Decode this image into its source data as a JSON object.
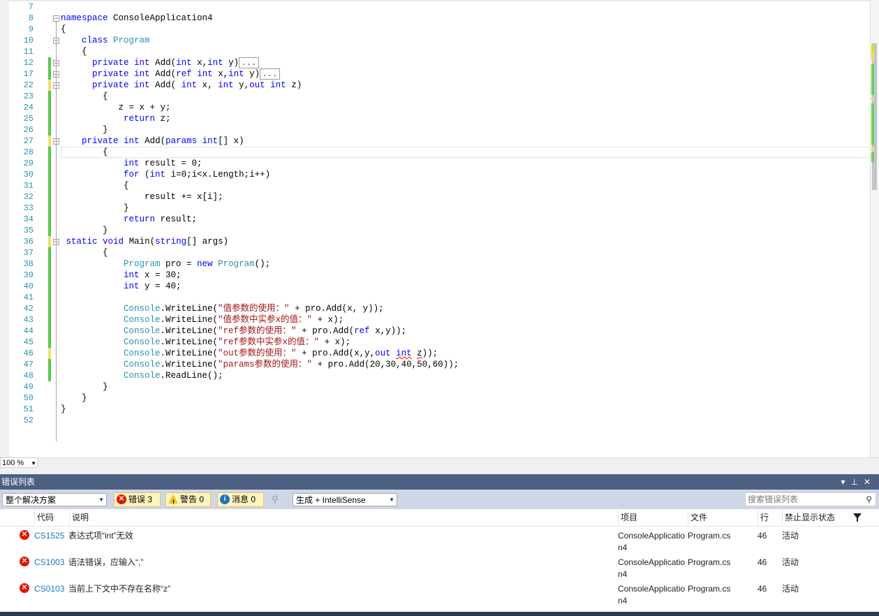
{
  "editor": {
    "lines": [
      {
        "n": "7",
        "segs": []
      },
      {
        "n": "8",
        "segs": [
          {
            "k": "kw",
            "t": "namespace"
          },
          {
            "t": " ConsoleApplication4"
          }
        ]
      },
      {
        "n": "9",
        "segs": [
          {
            "t": "{"
          }
        ]
      },
      {
        "n": "10",
        "segs": [
          {
            "t": "    "
          },
          {
            "k": "kw",
            "t": "class"
          },
          {
            "t": " "
          },
          {
            "k": "ty",
            "t": "Program"
          }
        ]
      },
      {
        "n": "11",
        "segs": [
          {
            "t": "    {"
          }
        ]
      },
      {
        "n": "12",
        "segs": [
          {
            "t": "      "
          },
          {
            "k": "kw",
            "t": "private"
          },
          {
            "t": " "
          },
          {
            "k": "kw",
            "t": "int"
          },
          {
            "t": " Add("
          },
          {
            "k": "kw",
            "t": "int"
          },
          {
            "t": " x,"
          },
          {
            "k": "kw",
            "t": "int"
          },
          {
            "t": " y)"
          },
          {
            "k": "collapsed",
            "t": "..."
          }
        ]
      },
      {
        "n": "17",
        "segs": [
          {
            "t": "      "
          },
          {
            "k": "kw",
            "t": "private"
          },
          {
            "t": " "
          },
          {
            "k": "kw",
            "t": "int"
          },
          {
            "t": " Add("
          },
          {
            "k": "kw",
            "t": "ref"
          },
          {
            "t": " "
          },
          {
            "k": "kw",
            "t": "int"
          },
          {
            "t": " x,"
          },
          {
            "k": "kw",
            "t": "int"
          },
          {
            "t": " y)"
          },
          {
            "k": "collapsed",
            "t": "..."
          }
        ]
      },
      {
        "n": "22",
        "segs": [
          {
            "t": "      "
          },
          {
            "k": "kw",
            "t": "private"
          },
          {
            "t": " "
          },
          {
            "k": "kw",
            "t": "int"
          },
          {
            "t": " Add( "
          },
          {
            "k": "kw",
            "t": "int"
          },
          {
            "t": " x, "
          },
          {
            "k": "kw",
            "t": "int"
          },
          {
            "t": " y,"
          },
          {
            "k": "kw",
            "t": "out"
          },
          {
            "t": " "
          },
          {
            "k": "kw",
            "t": "int"
          },
          {
            "t": " z)"
          }
        ]
      },
      {
        "n": "23",
        "segs": [
          {
            "t": "        {"
          }
        ]
      },
      {
        "n": "24",
        "segs": [
          {
            "t": "           z = x + y;"
          }
        ]
      },
      {
        "n": "25",
        "segs": [
          {
            "t": "            "
          },
          {
            "k": "kw",
            "t": "return"
          },
          {
            "t": " z;"
          }
        ]
      },
      {
        "n": "26",
        "segs": [
          {
            "t": "        }"
          }
        ]
      },
      {
        "n": "27",
        "segs": [
          {
            "t": "    "
          },
          {
            "k": "kw",
            "t": "private"
          },
          {
            "t": " "
          },
          {
            "k": "kw",
            "t": "int"
          },
          {
            "t": " Add("
          },
          {
            "k": "kw",
            "t": "params"
          },
          {
            "t": " "
          },
          {
            "k": "kw",
            "t": "int"
          },
          {
            "t": "[] x)"
          }
        ]
      },
      {
        "n": "28",
        "segs": [
          {
            "t": "        {"
          }
        ]
      },
      {
        "n": "29",
        "segs": [
          {
            "t": "            "
          },
          {
            "k": "kw",
            "t": "int"
          },
          {
            "t": " result = 0;"
          }
        ]
      },
      {
        "n": "30",
        "segs": [
          {
            "t": "            "
          },
          {
            "k": "kw",
            "t": "for"
          },
          {
            "t": " ("
          },
          {
            "k": "kw",
            "t": "int"
          },
          {
            "t": " i=0;i<x.Length;i++)"
          }
        ]
      },
      {
        "n": "31",
        "segs": [
          {
            "t": "            {"
          }
        ]
      },
      {
        "n": "32",
        "segs": [
          {
            "t": "                result += x[i];"
          }
        ]
      },
      {
        "n": "33",
        "segs": [
          {
            "t": "            }"
          }
        ]
      },
      {
        "n": "34",
        "segs": [
          {
            "t": "            "
          },
          {
            "k": "kw",
            "t": "return"
          },
          {
            "t": " result;"
          }
        ]
      },
      {
        "n": "35",
        "segs": [
          {
            "t": "        }"
          }
        ]
      },
      {
        "n": "36",
        "segs": [
          {
            "t": " "
          },
          {
            "k": "kw",
            "t": "static"
          },
          {
            "t": " "
          },
          {
            "k": "kw",
            "t": "void"
          },
          {
            "t": " Main("
          },
          {
            "k": "kw",
            "t": "string"
          },
          {
            "t": "[] args)"
          }
        ]
      },
      {
        "n": "37",
        "segs": [
          {
            "t": "        {"
          }
        ]
      },
      {
        "n": "38",
        "segs": [
          {
            "t": "            "
          },
          {
            "k": "ty",
            "t": "Program"
          },
          {
            "t": " pro = "
          },
          {
            "k": "kw",
            "t": "new"
          },
          {
            "t": " "
          },
          {
            "k": "ty",
            "t": "Program"
          },
          {
            "t": "();"
          }
        ]
      },
      {
        "n": "39",
        "segs": [
          {
            "t": "            "
          },
          {
            "k": "kw",
            "t": "int"
          },
          {
            "t": " x = 30;"
          }
        ]
      },
      {
        "n": "40",
        "segs": [
          {
            "t": "            "
          },
          {
            "k": "kw",
            "t": "int"
          },
          {
            "t": " y = 40;"
          }
        ]
      },
      {
        "n": "41",
        "segs": []
      },
      {
        "n": "42",
        "segs": [
          {
            "t": "            "
          },
          {
            "k": "ty",
            "t": "Console"
          },
          {
            "t": ".WriteLine("
          },
          {
            "k": "st",
            "t": "\"值参数的使用：\""
          },
          {
            "t": " + pro.Add(x, y));"
          }
        ]
      },
      {
        "n": "43",
        "segs": [
          {
            "t": "            "
          },
          {
            "k": "ty",
            "t": "Console"
          },
          {
            "t": ".WriteLine("
          },
          {
            "k": "st",
            "t": "\"值参数中实参x的值：\""
          },
          {
            "t": " + x);"
          }
        ]
      },
      {
        "n": "44",
        "segs": [
          {
            "t": "            "
          },
          {
            "k": "ty",
            "t": "Console"
          },
          {
            "t": ".WriteLine("
          },
          {
            "k": "st",
            "t": "\"ref参数的使用：\""
          },
          {
            "t": " + pro.Add("
          },
          {
            "k": "kw",
            "t": "ref"
          },
          {
            "t": " x,y));"
          }
        ]
      },
      {
        "n": "45",
        "segs": [
          {
            "t": "            "
          },
          {
            "k": "ty",
            "t": "Console"
          },
          {
            "t": ".WriteLine("
          },
          {
            "k": "st",
            "t": "\"ref参数中实参x的值：\""
          },
          {
            "t": " + x);"
          }
        ]
      },
      {
        "n": "46",
        "segs": [
          {
            "t": "            "
          },
          {
            "k": "ty",
            "t": "Console"
          },
          {
            "t": ".WriteLine("
          },
          {
            "k": "st",
            "t": "\"out参数的使用：\""
          },
          {
            "t": " + pro.Add(x,y,"
          },
          {
            "k": "kw",
            "t": "out"
          },
          {
            "t": " "
          },
          {
            "k": "kwsq",
            "t": "int"
          },
          {
            "t": " "
          },
          {
            "k": "sq",
            "t": "z"
          },
          {
            "t": "));"
          }
        ]
      },
      {
        "n": "47",
        "segs": [
          {
            "t": "            "
          },
          {
            "k": "ty",
            "t": "Console"
          },
          {
            "t": ".WriteLine("
          },
          {
            "k": "st",
            "t": "\"params参数的使用：\""
          },
          {
            "t": " + pro.Add(20,30,40,50,60));"
          }
        ]
      },
      {
        "n": "48",
        "segs": [
          {
            "t": "            "
          },
          {
            "k": "ty",
            "t": "Console"
          },
          {
            "t": ".ReadLine();"
          }
        ]
      },
      {
        "n": "49",
        "segs": [
          {
            "t": "        }"
          }
        ]
      },
      {
        "n": "50",
        "segs": [
          {
            "t": "    }"
          }
        ]
      },
      {
        "n": "51",
        "segs": [
          {
            "t": "}"
          }
        ]
      },
      {
        "n": "52",
        "segs": []
      }
    ],
    "zoom": "100 %"
  },
  "panel": {
    "title": "错误列表",
    "scope": "整个解决方案",
    "errors_label": "错误 3",
    "warnings_label": "警告 0",
    "messages_label": "消息 0",
    "build_filter": "生成 + IntelliSense",
    "search_placeholder": "搜索错误列表",
    "columns": {
      "code": "代码",
      "desc": "说明",
      "project": "项目",
      "file": "文件",
      "line": "行",
      "suppress": "禁止显示状态"
    },
    "rows": [
      {
        "code": "CS1525",
        "desc": "表达式项“int”无效",
        "project": "ConsoleApplication4",
        "file": "Program.cs",
        "line": "46",
        "state": "活动"
      },
      {
        "code": "CS1003",
        "desc": "语法错误，应输入“,”",
        "project": "ConsoleApplication4",
        "file": "Program.cs",
        "line": "46",
        "state": "活动"
      },
      {
        "code": "CS0103",
        "desc": "当前上下文中不存在名称“z”",
        "project": "ConsoleApplication4",
        "file": "Program.cs",
        "line": "46",
        "state": "活动"
      }
    ]
  },
  "colors": {
    "keyword": "#0000ff",
    "type": "#2b91af",
    "string": "#a31515",
    "error": "#e51400",
    "titlebar": "#4d6082"
  }
}
